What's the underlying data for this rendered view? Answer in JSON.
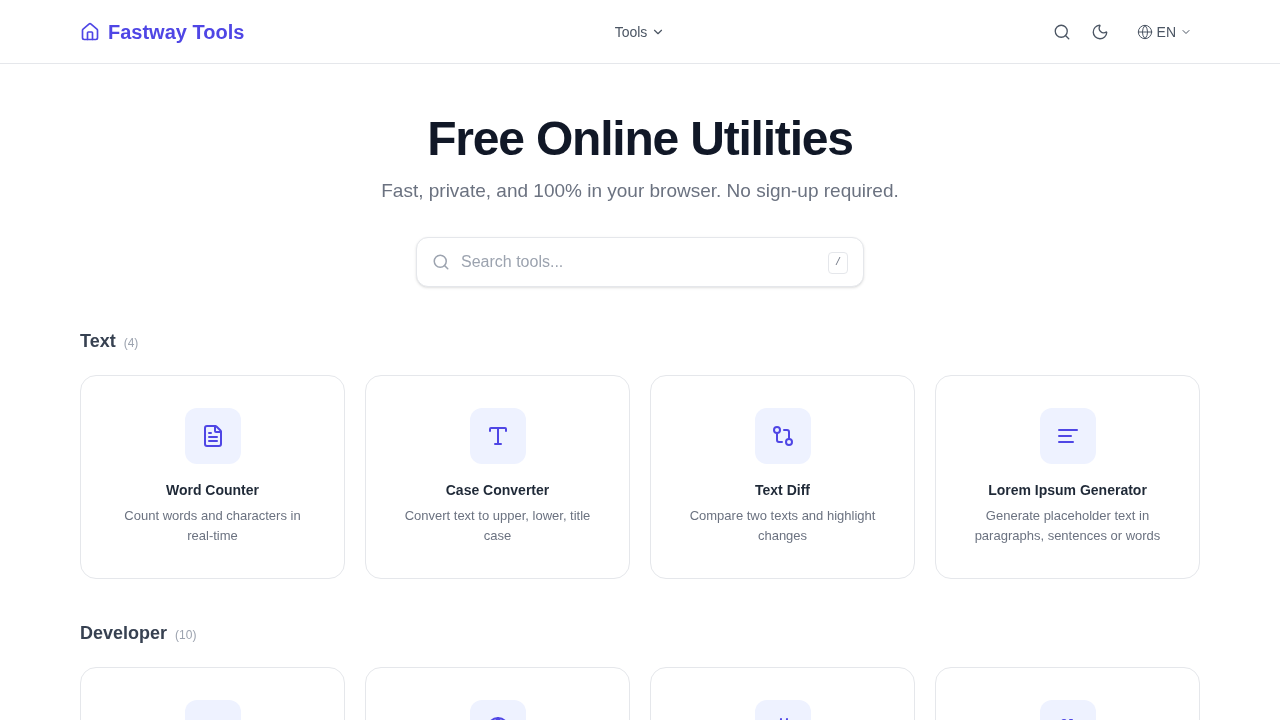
{
  "header": {
    "logo": {
      "text": "Fastway Tools"
    },
    "nav": {
      "label": "Tools"
    },
    "language": {
      "label": "EN"
    }
  },
  "hero": {
    "title": "Free Online Utilities",
    "subtitle": "Fast, private, and 100% in your browser. No sign-up required.",
    "search": {
      "placeholder": "Search tools...",
      "shortcut": "/"
    }
  },
  "sections": [
    {
      "title": "Text",
      "count": "(4)",
      "tools": [
        {
          "kind": "full",
          "name": "Word Counter",
          "description": "Count words and characters in real-time"
        },
        {
          "kind": "full",
          "name": "Case Converter",
          "description": "Convert text to upper, lower, title case"
        },
        {
          "kind": "full",
          "name": "Text Diff",
          "description": "Compare two texts and highlight changes"
        },
        {
          "kind": "full",
          "name": "Lorem Ipsum Generator",
          "description": "Generate placeholder text in paragraphs, sentences or words"
        }
      ]
    },
    {
      "title": "Developer",
      "count": "(10)",
      "tools": [
        {
          "kind": "clipped"
        },
        {
          "kind": "clipped"
        },
        {
          "kind": "clipped"
        },
        {
          "kind": "clipped"
        }
      ]
    }
  ]
}
